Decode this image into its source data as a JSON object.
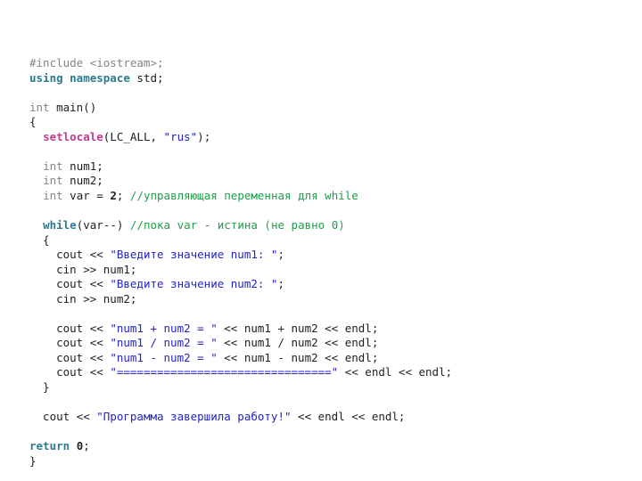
{
  "editor": {
    "language": "C++",
    "background_color": "#ffffff",
    "font_size_px": 12.5,
    "line_height_px": 16.55,
    "indent_spaces": 2,
    "palette": {
      "preprocessor": "#848484",
      "type": "#848484",
      "keyword": "#2A7B8F",
      "function": "#C4398F",
      "string": "#2323C8",
      "comment": "#1E9E4A",
      "plain": "#202020"
    }
  },
  "code_lines": [
    {
      "id": "line-1",
      "tokens": [
        {
          "cls": "t-pre",
          "text": "#include <iostream>;"
        }
      ]
    },
    {
      "id": "line-2",
      "tokens": [
        {
          "cls": "t-kw",
          "text": "using namespace"
        },
        {
          "cls": "t-plain",
          "text": " std;"
        }
      ]
    },
    {
      "id": "line-3",
      "tokens": [
        {
          "cls": "t-plain",
          "text": ""
        }
      ]
    },
    {
      "id": "line-4",
      "tokens": [
        {
          "cls": "t-type",
          "text": "int"
        },
        {
          "cls": "t-plain",
          "text": " main()"
        }
      ]
    },
    {
      "id": "line-5",
      "tokens": [
        {
          "cls": "t-plain",
          "text": "{"
        }
      ]
    },
    {
      "id": "line-6",
      "tokens": [
        {
          "cls": "t-plain",
          "text": "  "
        },
        {
          "cls": "t-fn",
          "text": "setlocale"
        },
        {
          "cls": "t-plain",
          "text": "(LC_ALL, "
        },
        {
          "cls": "t-str",
          "text": "\"rus\""
        },
        {
          "cls": "t-plain",
          "text": ");"
        }
      ]
    },
    {
      "id": "line-7",
      "tokens": [
        {
          "cls": "t-plain",
          "text": ""
        }
      ]
    },
    {
      "id": "line-8",
      "tokens": [
        {
          "cls": "t-plain",
          "text": "  "
        },
        {
          "cls": "t-type",
          "text": "int"
        },
        {
          "cls": "t-plain",
          "text": " num1;"
        }
      ]
    },
    {
      "id": "line-9",
      "tokens": [
        {
          "cls": "t-plain",
          "text": "  "
        },
        {
          "cls": "t-type",
          "text": "int"
        },
        {
          "cls": "t-plain",
          "text": " num2;"
        }
      ]
    },
    {
      "id": "line-10",
      "tokens": [
        {
          "cls": "t-plain",
          "text": "  "
        },
        {
          "cls": "t-type",
          "text": "int"
        },
        {
          "cls": "t-plain",
          "text": " var = "
        },
        {
          "cls": "t-num",
          "text": "2"
        },
        {
          "cls": "t-plain",
          "text": "; "
        },
        {
          "cls": "t-cmt",
          "text": "//управляющая переменная для while"
        }
      ]
    },
    {
      "id": "line-11",
      "tokens": [
        {
          "cls": "t-plain",
          "text": ""
        }
      ]
    },
    {
      "id": "line-12",
      "tokens": [
        {
          "cls": "t-plain",
          "text": "  "
        },
        {
          "cls": "t-kw",
          "text": "while"
        },
        {
          "cls": "t-plain",
          "text": "(var--) "
        },
        {
          "cls": "t-cmt",
          "text": "//пока var - истина (не равно 0)"
        }
      ]
    },
    {
      "id": "line-13",
      "tokens": [
        {
          "cls": "t-plain",
          "text": "  {"
        }
      ]
    },
    {
      "id": "line-14",
      "tokens": [
        {
          "cls": "t-plain",
          "text": "    cout << "
        },
        {
          "cls": "t-str",
          "text": "\"Введите значение num1: \""
        },
        {
          "cls": "t-plain",
          "text": ";"
        }
      ]
    },
    {
      "id": "line-15",
      "tokens": [
        {
          "cls": "t-plain",
          "text": "    cin >> num1;"
        }
      ]
    },
    {
      "id": "line-16",
      "tokens": [
        {
          "cls": "t-plain",
          "text": "    cout << "
        },
        {
          "cls": "t-str",
          "text": "\"Введите значение num2: \""
        },
        {
          "cls": "t-plain",
          "text": ";"
        }
      ]
    },
    {
      "id": "line-17",
      "tokens": [
        {
          "cls": "t-plain",
          "text": "    cin >> num2;"
        }
      ]
    },
    {
      "id": "line-18",
      "tokens": [
        {
          "cls": "t-plain",
          "text": ""
        }
      ]
    },
    {
      "id": "line-19",
      "tokens": [
        {
          "cls": "t-plain",
          "text": "    cout << "
        },
        {
          "cls": "t-str",
          "text": "\"num1 + num2 = \""
        },
        {
          "cls": "t-plain",
          "text": " << num1 + num2 << endl;"
        }
      ]
    },
    {
      "id": "line-20",
      "tokens": [
        {
          "cls": "t-plain",
          "text": "    cout << "
        },
        {
          "cls": "t-str",
          "text": "\"num1 / num2 = \""
        },
        {
          "cls": "t-plain",
          "text": " << num1 / num2 << endl;"
        }
      ]
    },
    {
      "id": "line-21",
      "tokens": [
        {
          "cls": "t-plain",
          "text": "    cout << "
        },
        {
          "cls": "t-str",
          "text": "\"num1 - num2 = \""
        },
        {
          "cls": "t-plain",
          "text": " << num1 - num2 << endl;"
        }
      ]
    },
    {
      "id": "line-22",
      "tokens": [
        {
          "cls": "t-plain",
          "text": "    cout << "
        },
        {
          "cls": "t-str",
          "text": "\"================================\""
        },
        {
          "cls": "t-plain",
          "text": " << endl << endl;"
        }
      ]
    },
    {
      "id": "line-23",
      "tokens": [
        {
          "cls": "t-plain",
          "text": "  }"
        }
      ]
    },
    {
      "id": "line-24",
      "tokens": [
        {
          "cls": "t-plain",
          "text": ""
        }
      ]
    },
    {
      "id": "line-25",
      "tokens": [
        {
          "cls": "t-plain",
          "text": "  cout << "
        },
        {
          "cls": "t-str",
          "text": "\"Программа завершила работу!\""
        },
        {
          "cls": "t-plain",
          "text": " << endl << endl;"
        }
      ]
    },
    {
      "id": "line-26",
      "tokens": [
        {
          "cls": "t-plain",
          "text": ""
        }
      ]
    },
    {
      "id": "line-27",
      "tokens": [
        {
          "cls": "t-kw",
          "text": "return"
        },
        {
          "cls": "t-plain",
          "text": " "
        },
        {
          "cls": "t-num",
          "text": "0"
        },
        {
          "cls": "t-plain",
          "text": ";"
        }
      ]
    },
    {
      "id": "line-28",
      "tokens": [
        {
          "cls": "t-plain",
          "text": "}"
        }
      ]
    }
  ]
}
